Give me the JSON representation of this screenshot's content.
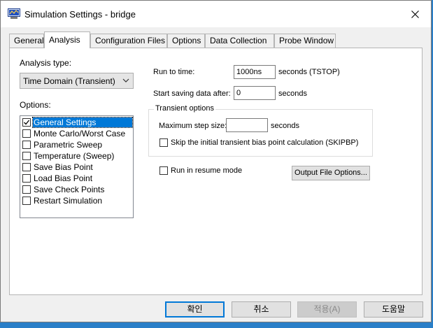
{
  "window": {
    "title": "Simulation Settings - bridge"
  },
  "tabs": [
    {
      "label": "General"
    },
    {
      "label": "Analysis"
    },
    {
      "label": "Configuration Files"
    },
    {
      "label": "Options"
    },
    {
      "label": "Data Collection"
    },
    {
      "label": "Probe Window"
    }
  ],
  "active_tab": "Analysis",
  "analysis": {
    "type_label": "Analysis type:",
    "type_value": "Time Domain (Transient)",
    "options_label": "Options:",
    "options": [
      {
        "label": "General Settings",
        "checked": true,
        "selected": true
      },
      {
        "label": "Monte Carlo/Worst Case",
        "checked": false
      },
      {
        "label": "Parametric Sweep",
        "checked": false
      },
      {
        "label": "Temperature (Sweep)",
        "checked": false
      },
      {
        "label": "Save Bias Point",
        "checked": false
      },
      {
        "label": "Load Bias Point",
        "checked": false
      },
      {
        "label": "Save Check Points",
        "checked": false
      },
      {
        "label": "Restart Simulation",
        "checked": false
      }
    ]
  },
  "settings": {
    "run_to_time_label": "Run to time:",
    "run_to_time_value": "1000ns",
    "run_to_time_unit": "seconds  (TSTOP)",
    "start_saving_label": "Start saving data after:",
    "start_saving_value": "0",
    "start_saving_unit": "seconds",
    "transient_group_title": "Transient options",
    "max_step_label": "Maximum step size:",
    "max_step_value": "",
    "max_step_unit": "seconds",
    "skip_bias_label": "Skip the initial transient bias point calculation  (SKIPBP)",
    "skip_bias_checked": false,
    "resume_mode_label": "Run in resume mode",
    "resume_mode_checked": false,
    "output_file_options_label": "Output File Options..."
  },
  "footer": {
    "ok_label": "확인",
    "cancel_label": "취소",
    "apply_label": "적용(A)",
    "help_label": "도움말"
  },
  "colors": {
    "selection": "#0078d7",
    "desktop": "#2a7fc8"
  }
}
